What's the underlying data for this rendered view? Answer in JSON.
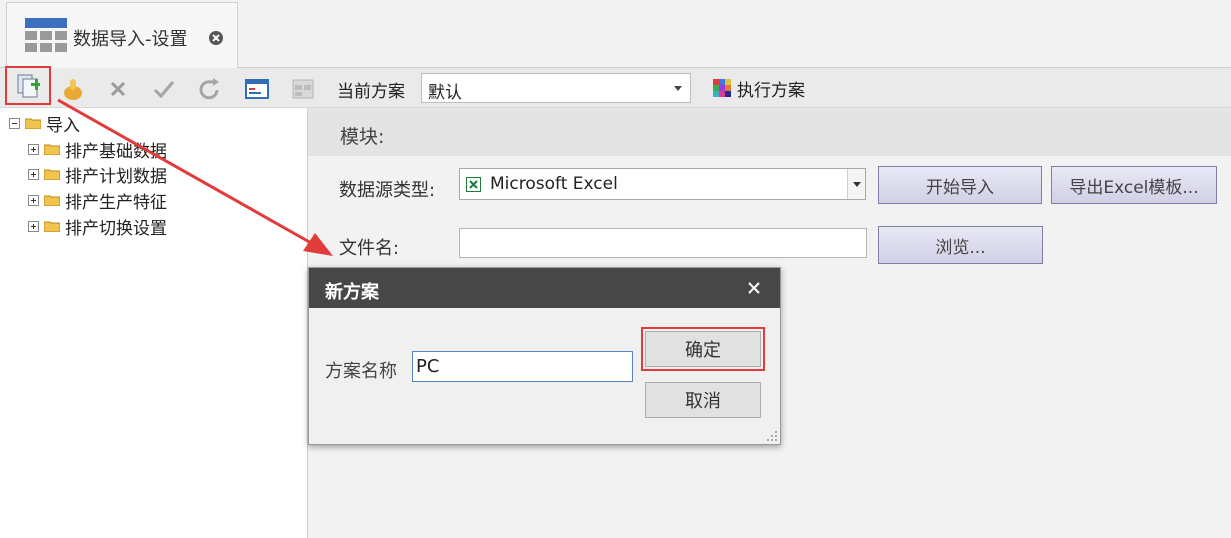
{
  "tab": {
    "title": "数据导入-设置"
  },
  "toolbar": {
    "scheme_label": "当前方案",
    "scheme_value": "默认",
    "execute_label": "执行方案"
  },
  "tree": {
    "root": "导入",
    "children": [
      "排产基础数据",
      "排产计划数据",
      "排产生产特征",
      "排产切换设置"
    ]
  },
  "panel": {
    "module_label": "模块:",
    "datasource_label": "数据源类型:",
    "datasource_value": "Microsoft Excel",
    "start_import_label": "开始导入",
    "export_template_label": "导出Excel模板...",
    "filename_label": "文件名:",
    "filename_value": "",
    "browse_label": "浏览..."
  },
  "dialog": {
    "title": "新方案",
    "name_label": "方案名称",
    "name_value": "PC",
    "ok_label": "确定",
    "cancel_label": "取消"
  },
  "colors": {
    "highlight": "#e23b3b",
    "dialog_header": "#474747",
    "button_fill": "#d1d0e6"
  }
}
